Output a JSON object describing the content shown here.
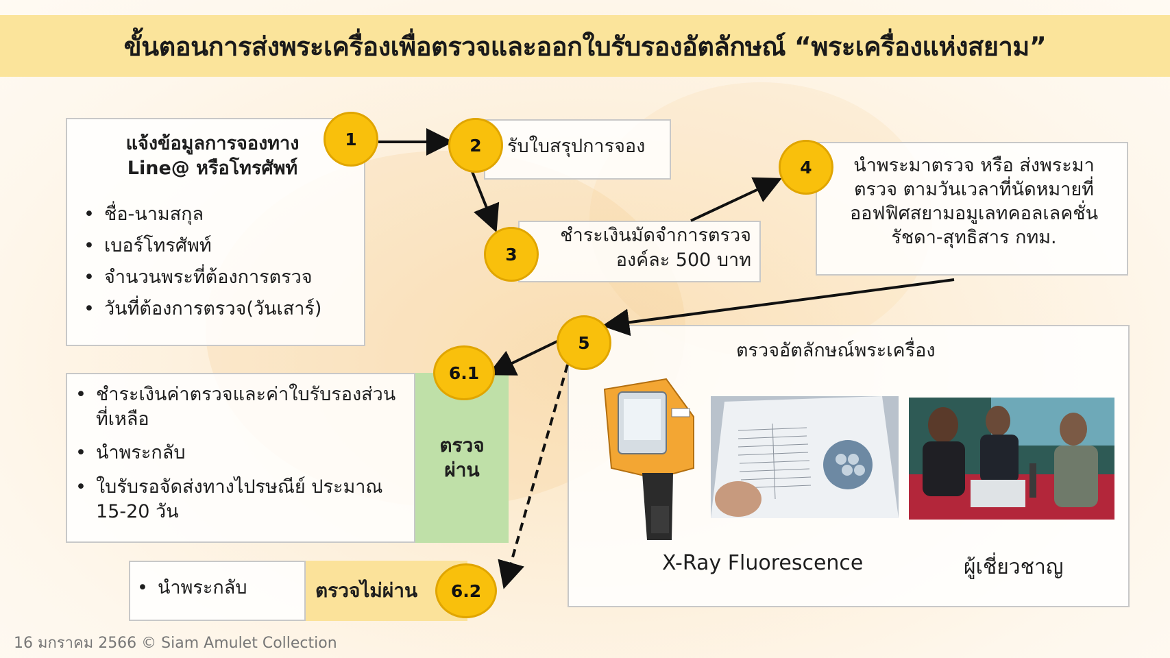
{
  "title": "ขั้นตอนการส่งพระเครื่องเพื่อตรวจและออกใบรับรองอัตลักษณ์ “พระเครื่องแห่งสยาม”",
  "steps": {
    "s1": {
      "num": "1",
      "heading_line1": "แจ้งข้อมูลการจองทาง",
      "heading_line2": "Line@ หรือโทรศัพท์",
      "items": [
        "ชื่อ-นามสกุล",
        "เบอร์โทรศัพท์",
        "จำนวนพระที่ต้องการตรวจ",
        "วันที่ต้องการตรวจ(วันเสาร์)"
      ]
    },
    "s2": {
      "num": "2",
      "text": "รับใบสรุปการจอง"
    },
    "s3": {
      "num": "3",
      "line1": "ชำระเงินมัดจำการตรวจ",
      "line2": "องค์ละ 500 บาท"
    },
    "s4": {
      "num": "4",
      "line1": "นำพระมาตรวจ หรือ ส่งพระมา",
      "line2": "ตรวจ ตามวันเวลาที่นัดหมายที่",
      "line3": "ออฟฟิศสยามอมูเลทคอลเลคชั่น",
      "line4": "รัชดา-สุทธิสาร กทม."
    },
    "s5": {
      "num": "5",
      "heading": "ตรวจอัตลักษณ์พระเครื่อง",
      "caption_left": "X-Ray Fluorescence",
      "caption_right": "ผู้เชี่ยวชาญ"
    },
    "s61": {
      "num": "6.1",
      "items": [
        "ชำระเงินค่าตรวจและค่าใบรับรองส่วนที่เหลือ",
        "นำพระกลับ",
        "ใบรับรอจัดส่งทางไปรษณีย์ ประมาณ 15-20 วัน"
      ],
      "status_line1": "ตรวจ",
      "status_line2": "ผ่าน"
    },
    "s62": {
      "num": "6.2",
      "item": "นำพระกลับ",
      "status": "ตรวจไม่ผ่าน"
    }
  },
  "footer": "16 มกราคม 2566 © Siam Amulet Collection",
  "colors": {
    "circle": "#f9c00c",
    "title_bar": "#fbe49b",
    "pass": "#bfe0a8",
    "fail": "#fbe29a"
  },
  "icons": [
    "xrf-analyzer-image",
    "test-report-image",
    "experts-photo"
  ]
}
